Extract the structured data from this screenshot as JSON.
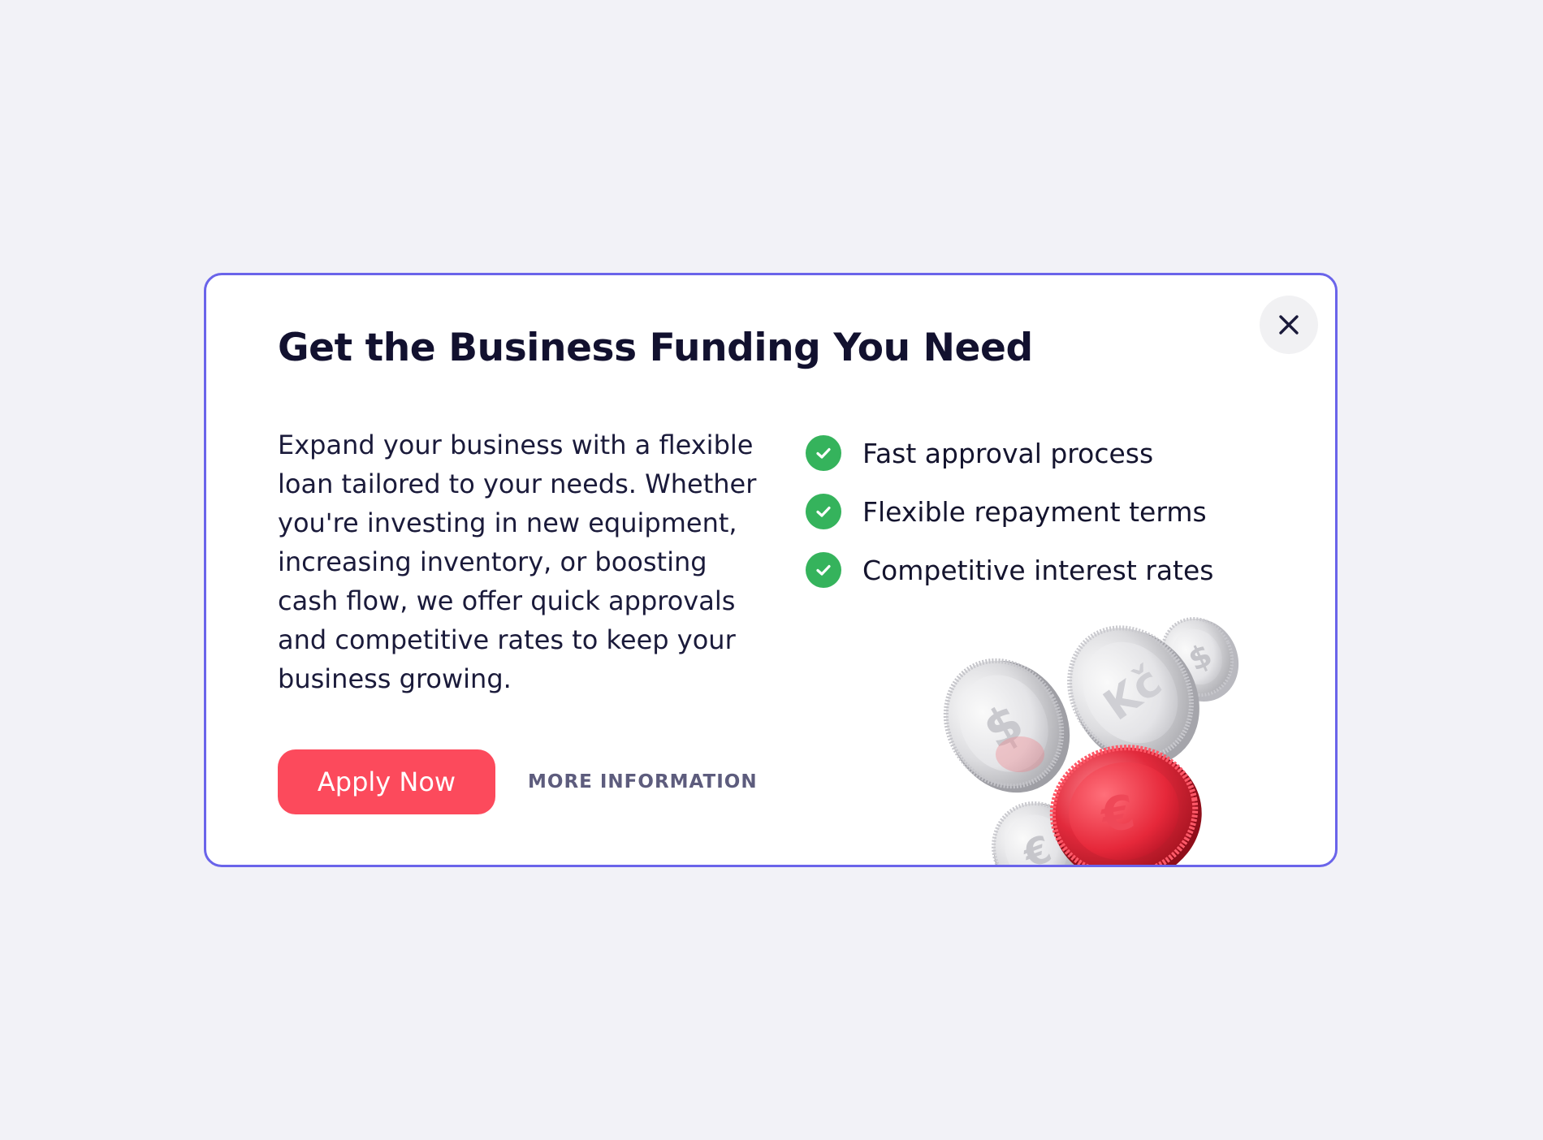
{
  "modal": {
    "title": "Get the Business Funding You Need",
    "description": "Expand your business with a flexible loan tailored to your needs. Whether you're investing in new equipment, increasing inventory, or boosting cash flow, we offer quick approvals and competitive rates to keep your business growing.",
    "features": [
      {
        "label": "Fast approval process",
        "icon": "check-circle-icon"
      },
      {
        "label": "Flexible repayment terms",
        "icon": "check-circle-icon"
      },
      {
        "label": "Competitive interest rates",
        "icon": "check-circle-icon"
      }
    ],
    "primary_button_label": "Apply Now",
    "secondary_link_label": "MORE INFORMATION",
    "close_icon": "close-icon",
    "illustration": "coins-illustration",
    "illustration_coin_symbols": [
      "$",
      "Kč",
      "$",
      "€",
      "€"
    ]
  },
  "colors": {
    "page_background": "#f2f2f7",
    "modal_border": "#6a64ea",
    "title_text": "#12112f",
    "primary_button": "#fc4a5c",
    "check_green": "#35b35c",
    "secondary_link": "#5d5c7d",
    "close_button_bg": "#f1f1f3"
  }
}
